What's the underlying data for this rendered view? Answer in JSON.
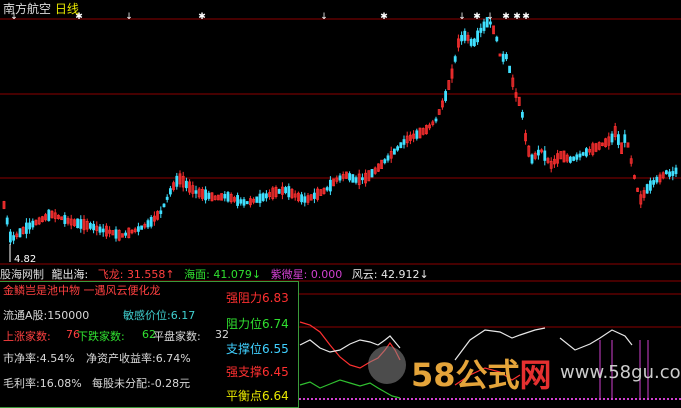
{
  "window": {
    "stock_name": "南方航空",
    "timeframe": "日线"
  },
  "price_axis": {
    "low_label": "4.82"
  },
  "indicator_bar": {
    "name": "股海网制",
    "items": [
      {
        "label": "龍出海:",
        "value": "",
        "color": "#e8e8e8"
      },
      {
        "label": "飞龙:",
        "value": "31.558↑",
        "color": "#ff4040"
      },
      {
        "label": "海面:",
        "value": "41.079↓",
        "color": "#30e030"
      },
      {
        "label": "紫微星:",
        "value": "0.000",
        "color": "#d040d0"
      },
      {
        "label": "风云:",
        "value": "42.912↓",
        "color": "#e8e8e8"
      }
    ]
  },
  "info_panel": {
    "headline": "金鳞岂是池中物  一遇风云便化龙",
    "rows": [
      {
        "label": "流通A股:",
        "value": "150000",
        "value_color": "#d8d8d8"
      },
      {
        "label": "敏感价位:",
        "value": "6.17",
        "value_color": "#40d0d0"
      },
      {
        "label": "上涨家数:",
        "value": "76",
        "value_color": "#ff4040"
      },
      {
        "label": "下跌家数:",
        "value": "62",
        "value_color": "#30e030"
      },
      {
        "label": "平盘家数:",
        "value": "32",
        "value_color": "#d8d8d8"
      },
      {
        "label": "市净率:",
        "value": "4.54%",
        "value_color": "#d8d8d8"
      },
      {
        "label": "净资产收益率:",
        "value": "6.74%",
        "value_color": "#d8d8d8"
      },
      {
        "label": "毛利率:",
        "value": "16.08%",
        "value_color": "#d8d8d8"
      },
      {
        "label": "每股未分配:",
        "value": "-0.28元",
        "value_color": "#d8d8d8"
      }
    ]
  },
  "levels": [
    {
      "label": "强阻力",
      "value": "6.83",
      "color": "#ff3030"
    },
    {
      "label": "阻力位",
      "value": "6.74",
      "color": "#30e030"
    },
    {
      "label": "支撑位",
      "value": "6.55",
      "color": "#40d0ff"
    },
    {
      "label": "强支撑",
      "value": "6.45",
      "color": "#ff3030"
    },
    {
      "label": "平衡点",
      "value": "6.64",
      "color": "#e8e800"
    }
  ],
  "watermark": {
    "main": "58公式",
    "accent": "网",
    "url": "www.58gu.com"
  },
  "colors": {
    "up": "#ff3030",
    "down": "#40e0ff",
    "grid": "#8b0000",
    "signal": "#ffffff"
  }
}
